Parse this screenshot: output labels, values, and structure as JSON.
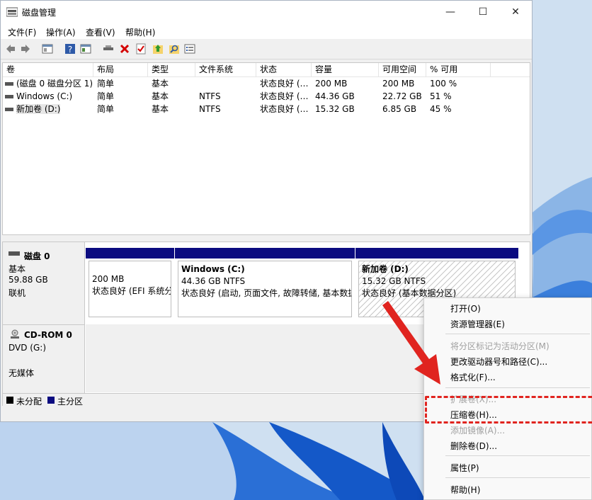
{
  "window": {
    "title": "磁盘管理",
    "controls": {
      "minimize": "—",
      "maximize": "☐",
      "close": "✕"
    }
  },
  "menu": [
    "文件(F)",
    "操作(A)",
    "查看(V)",
    "帮助(H)"
  ],
  "toolbar": {
    "icons": [
      "back-arrow-icon",
      "forward-arrow-icon",
      "properties-icon",
      "help-icon",
      "console-icon",
      "connect-icon",
      "delete-icon",
      "check-icon",
      "up-arrow-icon",
      "search-icon",
      "list-icon"
    ]
  },
  "volume_list": {
    "columns": [
      "卷",
      "布局",
      "类型",
      "文件系统",
      "状态",
      "容量",
      "可用空间",
      "% 可用"
    ],
    "rows": [
      {
        "volume": "(磁盘 0 磁盘分区 1)",
        "layout": "简单",
        "type": "基本",
        "fs": "",
        "status": "状态良好 (…",
        "capacity": "200 MB",
        "free": "200 MB",
        "pct": "100 %"
      },
      {
        "volume": "Windows (C:)",
        "layout": "简单",
        "type": "基本",
        "fs": "NTFS",
        "status": "状态良好 (…",
        "capacity": "44.36 GB",
        "free": "22.72 GB",
        "pct": "51 %"
      },
      {
        "volume": "新加卷 (D:)",
        "layout": "简单",
        "type": "基本",
        "fs": "NTFS",
        "status": "状态良好 (…",
        "capacity": "15.32 GB",
        "free": "6.85 GB",
        "pct": "45 %"
      }
    ]
  },
  "disks": {
    "disk0": {
      "name": "磁盘 0",
      "type": "基本",
      "size": "59.88 GB",
      "state": "联机"
    },
    "cdrom0": {
      "name": "CD-ROM 0",
      "drive": "DVD (G:)",
      "media": "无媒体"
    }
  },
  "partitions": [
    {
      "title": "",
      "line1": "200 MB",
      "line2": "状态良好 (EFI 系统分"
    },
    {
      "title": "Windows  (C:)",
      "line1": "44.36 GB NTFS",
      "line2": "状态良好 (启动, 页面文件, 故障转储, 基本数据"
    },
    {
      "title": "新加卷  (D:)",
      "line1": "15.32 GB NTFS",
      "line2": "状态良好 (基本数据分区)"
    }
  ],
  "legend": {
    "unallocated": "未分配",
    "primary": "主分区",
    "colors": {
      "unallocated": "#000000",
      "primary": "#0b0b80"
    }
  },
  "context_menu": {
    "items": [
      {
        "label": "打开(O)",
        "enabled": true
      },
      {
        "label": "资源管理器(E)",
        "enabled": true
      },
      {
        "label": "将分区标记为活动分区(M)",
        "enabled": false
      },
      {
        "label": "更改驱动器号和路径(C)...",
        "enabled": true
      },
      {
        "label": "格式化(F)...",
        "enabled": true
      },
      {
        "label": "扩展卷(X)...",
        "enabled": false
      },
      {
        "label": "压缩卷(H)...",
        "enabled": true
      },
      {
        "label": "添加镜像(A)...",
        "enabled": false
      },
      {
        "label": "删除卷(D)...",
        "enabled": true
      },
      {
        "label": "属性(P)",
        "enabled": true
      },
      {
        "label": "帮助(H)",
        "enabled": true
      }
    ]
  },
  "annotation": {
    "highlight_color": "#e0241f"
  }
}
